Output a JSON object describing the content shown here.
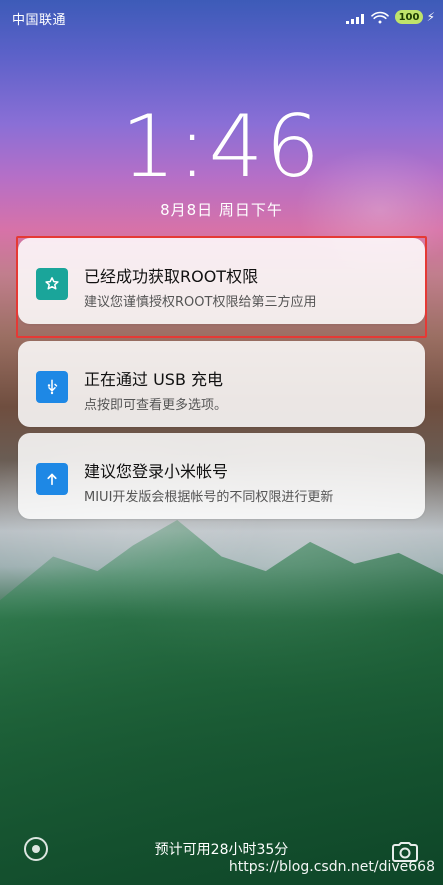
{
  "status_bar": {
    "carrier": "中国联通",
    "battery_level": "100"
  },
  "lock": {
    "time": "1:46",
    "date": "8月8日 周日下午"
  },
  "notifications": [
    {
      "title": "已经成功获取ROOT权限",
      "subtitle": "建议您谨慎授权ROOT权限给第三方应用",
      "icon": "star-icon",
      "icon_bg": "#1aa59a"
    },
    {
      "title": "正在通过 USB 充电",
      "subtitle": "点按即可查看更多选项。",
      "icon": "usb-icon",
      "icon_bg": "#1e88e5"
    },
    {
      "title": "建议您登录小米帐号",
      "subtitle": "MIUI开发版会根据帐号的不同权限进行更新",
      "icon": "arrow-up-icon",
      "icon_bg": "#1e88e5"
    }
  ],
  "bottom": {
    "battery_estimate": "预计可用28小时35分",
    "watermark": "https://blog.csdn.net/dive668"
  },
  "colors": {
    "highlight_border": "#e53935",
    "battery_fill": "#bfe36b"
  }
}
